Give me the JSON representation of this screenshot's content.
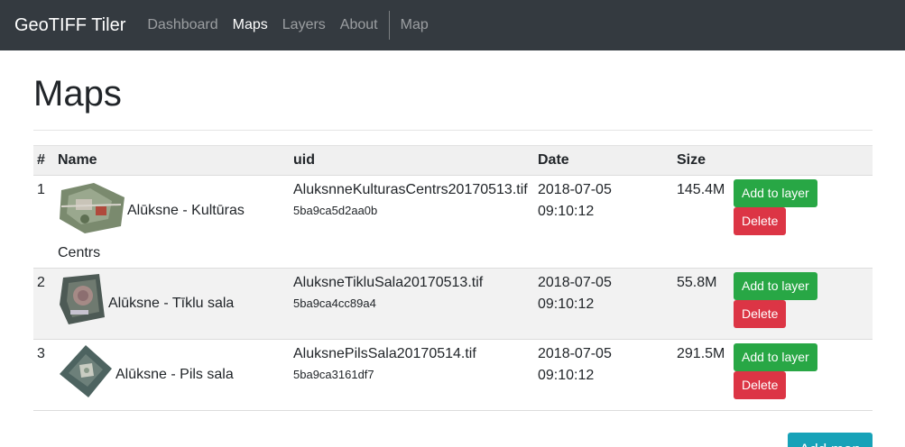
{
  "navbar": {
    "brand": "GeoTIFF Tiler",
    "links": [
      {
        "label": "Dashboard",
        "active": false
      },
      {
        "label": "Maps",
        "active": true
      },
      {
        "label": "Layers",
        "active": false
      },
      {
        "label": "About",
        "active": false
      }
    ],
    "extra_link": "Map"
  },
  "page": {
    "title": "Maps",
    "add_button": "Add map"
  },
  "table": {
    "headers": [
      "#",
      "Name",
      "uid",
      "Date",
      "Size"
    ],
    "rows": [
      {
        "num": "1",
        "name_line1": "Alūksne - Kultūras",
        "name_line2": "Centrs",
        "uid_file": "AluksnneKulturasCentrs20170513.tif",
        "uid_id": "5ba9ca5d2aa0b",
        "date": "2018-07-05",
        "time": "09:10:12",
        "size": "145.4M",
        "add_label": "Add to layer",
        "delete_label": "Delete"
      },
      {
        "num": "2",
        "name_line1": "Alūksne - Tīklu sala",
        "name_line2": "",
        "uid_file": "AluksneTikluSala20170513.tif",
        "uid_id": "5ba9ca4cc89a4",
        "date": "2018-07-05",
        "time": "09:10:12",
        "size": "55.8M",
        "add_label": "Add to layer",
        "delete_label": "Delete"
      },
      {
        "num": "3",
        "name_line1": "Alūksne - Pils sala",
        "name_line2": "",
        "uid_file": "AluksnePilsSala20170514.tif",
        "uid_id": "5ba9ca3161df7",
        "date": "2018-07-05",
        "time": "09:10:12",
        "size": "291.5M",
        "add_label": "Add to layer",
        "delete_label": "Delete"
      }
    ]
  },
  "colors": {
    "navbar_bg": "#343a40",
    "success": "#28a745",
    "danger": "#dc3545",
    "info": "#17a2b8"
  }
}
